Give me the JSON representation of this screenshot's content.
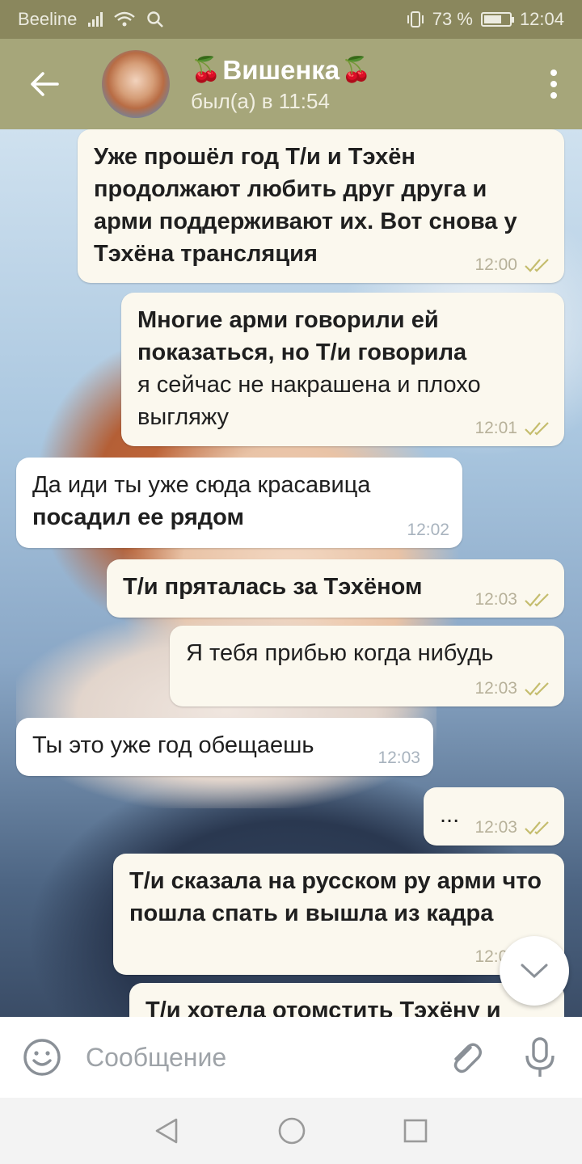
{
  "status_bar": {
    "carrier": "Beeline",
    "battery": "73 %",
    "battery_level": 0.73,
    "time": "12:04"
  },
  "header": {
    "title": "Вишенка",
    "subtitle": "был(а) в 11:54",
    "icons": [
      "back-arrow-icon",
      "cherry-icon",
      "more-vert-icon"
    ]
  },
  "messages": [
    {
      "text": "Уже прошёл год Т/и и Тэхён продолжают любить друг друга и арми поддерживают их. Вот снова у Тэхёна трансляция",
      "time": "12:00",
      "direction": "out",
      "read": true
    },
    {
      "text": "Многие арми говорили ей показаться, но Т/и говорила",
      "text2": "я сейчас не накрашена и плохо выгляжу",
      "time": "12:01",
      "direction": "out",
      "read": true
    },
    {
      "text": "Да иди ты уже сюда красавица",
      "text2": "посадил ее рядом",
      "time": "12:02",
      "direction": "in"
    },
    {
      "text": "Т/и пряталась за Тэхёном",
      "time": "12:03",
      "direction": "out",
      "read": true
    },
    {
      "text": "Я тебя прибью когда нибудь",
      "time": "12:03",
      "direction": "out",
      "read": true
    },
    {
      "text": "Ты это уже год обещаешь",
      "time": "12:03",
      "direction": "in"
    },
    {
      "text": "...",
      "time": "12:03",
      "direction": "out",
      "read": true
    },
    {
      "text": "Т/и сказала на русском ру арми что пошла спать и вышла из кадра",
      "time": "12:03",
      "direction": "out",
      "read": true
    },
    {
      "text": "Т/и хотела отомстить Тэхёну и",
      "direction": "out"
    }
  ],
  "input": {
    "placeholder": "Сообщение",
    "icons": [
      "emoji-icon",
      "attach-icon",
      "mic-icon"
    ]
  },
  "colors": {
    "header_bg": "#a6a67a",
    "status_bg": "#8a875d",
    "out_bubble": "#fbf8ee",
    "in_bubble": "#ffffff",
    "read_tick": "#c5bd6e"
  }
}
